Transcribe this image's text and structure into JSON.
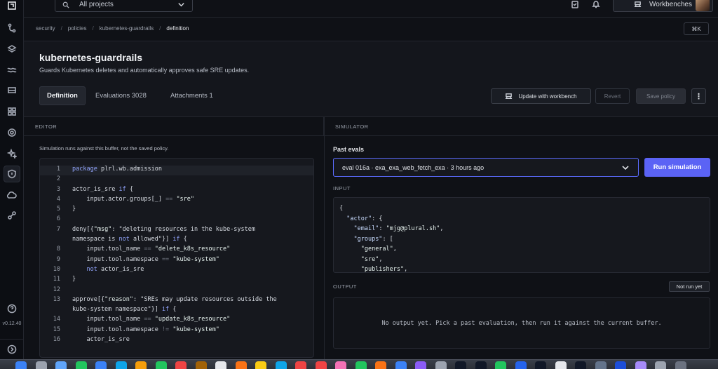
{
  "topbar": {
    "project_select": "All projects",
    "workbenches_label": "Workbenches"
  },
  "breadcrumb": [
    "security",
    "policies",
    "kubernetes-guardrails",
    "definition"
  ],
  "shortcut": "⌘K",
  "rail": {
    "version": "v0.12.40",
    "icons": [
      "logo-icon",
      "git-icon",
      "layers-icon",
      "waves-icon",
      "stack-icon",
      "grid-icon",
      "target-icon",
      "sparkles-icon",
      "shield-icon",
      "cloud-icon",
      "flow-icon",
      "help-icon",
      "expand-icon"
    ]
  },
  "policy": {
    "title": "kubernetes-guardrails",
    "description": "Guards Kubernetes deletes and automatically approves safe SRE updates."
  },
  "tabs": [
    {
      "label": "Definition",
      "active": true
    },
    {
      "label": "Evaluations 3028",
      "active": false
    },
    {
      "label": "Attachments 1",
      "active": false
    }
  ],
  "actions": {
    "update_workbench": "Update with workbench",
    "revert": "Revert",
    "save": "Save policy",
    "more": "⋮"
  },
  "editor": {
    "header": "EDITOR",
    "note": "Simulation runs against this buffer, not the saved policy.",
    "lines": [
      {
        "n": "1",
        "text": "package plrl.wb.admission"
      },
      {
        "n": "2",
        "text": ""
      },
      {
        "n": "3",
        "text": "actor_is_sre if {"
      },
      {
        "n": "4",
        "text": "    input.actor.groups[_] == \"sre\""
      },
      {
        "n": "5",
        "text": "}"
      },
      {
        "n": "6",
        "text": ""
      },
      {
        "n": "7",
        "text": "deny[{\"msg\": \"deleting resources in the kube-system"
      },
      {
        "n": "",
        "text": "namespace is not allowed\"}] if {"
      },
      {
        "n": "8",
        "text": "    input.tool_name == \"delete_k8s_resource\""
      },
      {
        "n": "9",
        "text": "    input.tool.namespace == \"kube-system\""
      },
      {
        "n": "10",
        "text": "    not actor_is_sre"
      },
      {
        "n": "11",
        "text": "}"
      },
      {
        "n": "12",
        "text": ""
      },
      {
        "n": "13",
        "text": "approve[{\"reason\": \"SREs may update resources outside the"
      },
      {
        "n": "",
        "text": "kube-system namespace\"}] if {"
      },
      {
        "n": "14",
        "text": "    input.tool_name == \"update_k8s_resource\""
      },
      {
        "n": "15",
        "text": "    input.tool.namespace != \"kube-system\""
      },
      {
        "n": "16",
        "text": "    actor_is_sre"
      }
    ]
  },
  "simulator": {
    "header": "SIMULATOR",
    "past_evals_label": "Past evals",
    "selected_eval": "eval 016a · exa_exa_web_fetch_exa · 3 hours ago",
    "run_label": "Run simulation",
    "input_label": "INPUT",
    "input_lines": [
      "{",
      "  \"actor\": {",
      "    \"email\": \"mjg@plural.sh\",",
      "    \"groups\": [",
      "      \"general\",",
      "      \"sre\",",
      "      \"publishers\","
    ],
    "output_label": "OUTPUT",
    "status_badge": "Not run yet",
    "output_empty": "No output yet. Pick a past evaluation, then run it against the current buffer."
  },
  "colors": {
    "accent": "#5b63f5",
    "background": "#0f1116",
    "panel": "#14161c",
    "notification": "#e5484d"
  }
}
